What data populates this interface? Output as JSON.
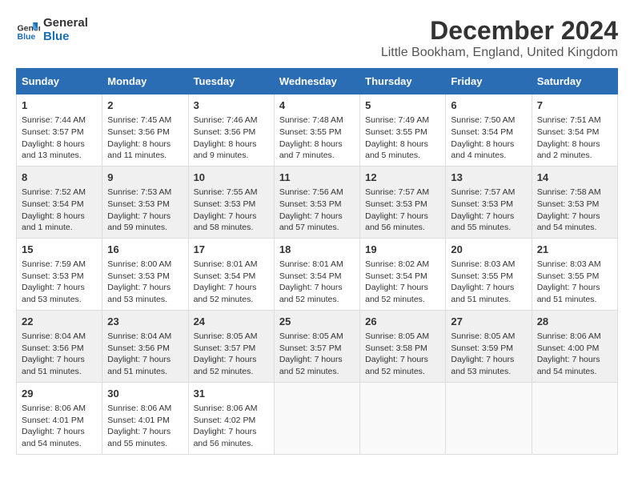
{
  "logo": {
    "line1": "General",
    "line2": "Blue"
  },
  "title": "December 2024",
  "subtitle": "Little Bookham, England, United Kingdom",
  "days_header": [
    "Sunday",
    "Monday",
    "Tuesday",
    "Wednesday",
    "Thursday",
    "Friday",
    "Saturday"
  ],
  "weeks": [
    [
      {
        "day": "1",
        "info": "Sunrise: 7:44 AM\nSunset: 3:57 PM\nDaylight: 8 hours\nand 13 minutes."
      },
      {
        "day": "2",
        "info": "Sunrise: 7:45 AM\nSunset: 3:56 PM\nDaylight: 8 hours\nand 11 minutes."
      },
      {
        "day": "3",
        "info": "Sunrise: 7:46 AM\nSunset: 3:56 PM\nDaylight: 8 hours\nand 9 minutes."
      },
      {
        "day": "4",
        "info": "Sunrise: 7:48 AM\nSunset: 3:55 PM\nDaylight: 8 hours\nand 7 minutes."
      },
      {
        "day": "5",
        "info": "Sunrise: 7:49 AM\nSunset: 3:55 PM\nDaylight: 8 hours\nand 5 minutes."
      },
      {
        "day": "6",
        "info": "Sunrise: 7:50 AM\nSunset: 3:54 PM\nDaylight: 8 hours\nand 4 minutes."
      },
      {
        "day": "7",
        "info": "Sunrise: 7:51 AM\nSunset: 3:54 PM\nDaylight: 8 hours\nand 2 minutes."
      }
    ],
    [
      {
        "day": "8",
        "info": "Sunrise: 7:52 AM\nSunset: 3:54 PM\nDaylight: 8 hours\nand 1 minute."
      },
      {
        "day": "9",
        "info": "Sunrise: 7:53 AM\nSunset: 3:53 PM\nDaylight: 7 hours\nand 59 minutes."
      },
      {
        "day": "10",
        "info": "Sunrise: 7:55 AM\nSunset: 3:53 PM\nDaylight: 7 hours\nand 58 minutes."
      },
      {
        "day": "11",
        "info": "Sunrise: 7:56 AM\nSunset: 3:53 PM\nDaylight: 7 hours\nand 57 minutes."
      },
      {
        "day": "12",
        "info": "Sunrise: 7:57 AM\nSunset: 3:53 PM\nDaylight: 7 hours\nand 56 minutes."
      },
      {
        "day": "13",
        "info": "Sunrise: 7:57 AM\nSunset: 3:53 PM\nDaylight: 7 hours\nand 55 minutes."
      },
      {
        "day": "14",
        "info": "Sunrise: 7:58 AM\nSunset: 3:53 PM\nDaylight: 7 hours\nand 54 minutes."
      }
    ],
    [
      {
        "day": "15",
        "info": "Sunrise: 7:59 AM\nSunset: 3:53 PM\nDaylight: 7 hours\nand 53 minutes."
      },
      {
        "day": "16",
        "info": "Sunrise: 8:00 AM\nSunset: 3:53 PM\nDaylight: 7 hours\nand 53 minutes."
      },
      {
        "day": "17",
        "info": "Sunrise: 8:01 AM\nSunset: 3:54 PM\nDaylight: 7 hours\nand 52 minutes."
      },
      {
        "day": "18",
        "info": "Sunrise: 8:01 AM\nSunset: 3:54 PM\nDaylight: 7 hours\nand 52 minutes."
      },
      {
        "day": "19",
        "info": "Sunrise: 8:02 AM\nSunset: 3:54 PM\nDaylight: 7 hours\nand 52 minutes."
      },
      {
        "day": "20",
        "info": "Sunrise: 8:03 AM\nSunset: 3:55 PM\nDaylight: 7 hours\nand 51 minutes."
      },
      {
        "day": "21",
        "info": "Sunrise: 8:03 AM\nSunset: 3:55 PM\nDaylight: 7 hours\nand 51 minutes."
      }
    ],
    [
      {
        "day": "22",
        "info": "Sunrise: 8:04 AM\nSunset: 3:56 PM\nDaylight: 7 hours\nand 51 minutes."
      },
      {
        "day": "23",
        "info": "Sunrise: 8:04 AM\nSunset: 3:56 PM\nDaylight: 7 hours\nand 51 minutes."
      },
      {
        "day": "24",
        "info": "Sunrise: 8:05 AM\nSunset: 3:57 PM\nDaylight: 7 hours\nand 52 minutes."
      },
      {
        "day": "25",
        "info": "Sunrise: 8:05 AM\nSunset: 3:57 PM\nDaylight: 7 hours\nand 52 minutes."
      },
      {
        "day": "26",
        "info": "Sunrise: 8:05 AM\nSunset: 3:58 PM\nDaylight: 7 hours\nand 52 minutes."
      },
      {
        "day": "27",
        "info": "Sunrise: 8:05 AM\nSunset: 3:59 PM\nDaylight: 7 hours\nand 53 minutes."
      },
      {
        "day": "28",
        "info": "Sunrise: 8:06 AM\nSunset: 4:00 PM\nDaylight: 7 hours\nand 54 minutes."
      }
    ],
    [
      {
        "day": "29",
        "info": "Sunrise: 8:06 AM\nSunset: 4:01 PM\nDaylight: 7 hours\nand 54 minutes."
      },
      {
        "day": "30",
        "info": "Sunrise: 8:06 AM\nSunset: 4:01 PM\nDaylight: 7 hours\nand 55 minutes."
      },
      {
        "day": "31",
        "info": "Sunrise: 8:06 AM\nSunset: 4:02 PM\nDaylight: 7 hours\nand 56 minutes."
      },
      null,
      null,
      null,
      null
    ]
  ]
}
